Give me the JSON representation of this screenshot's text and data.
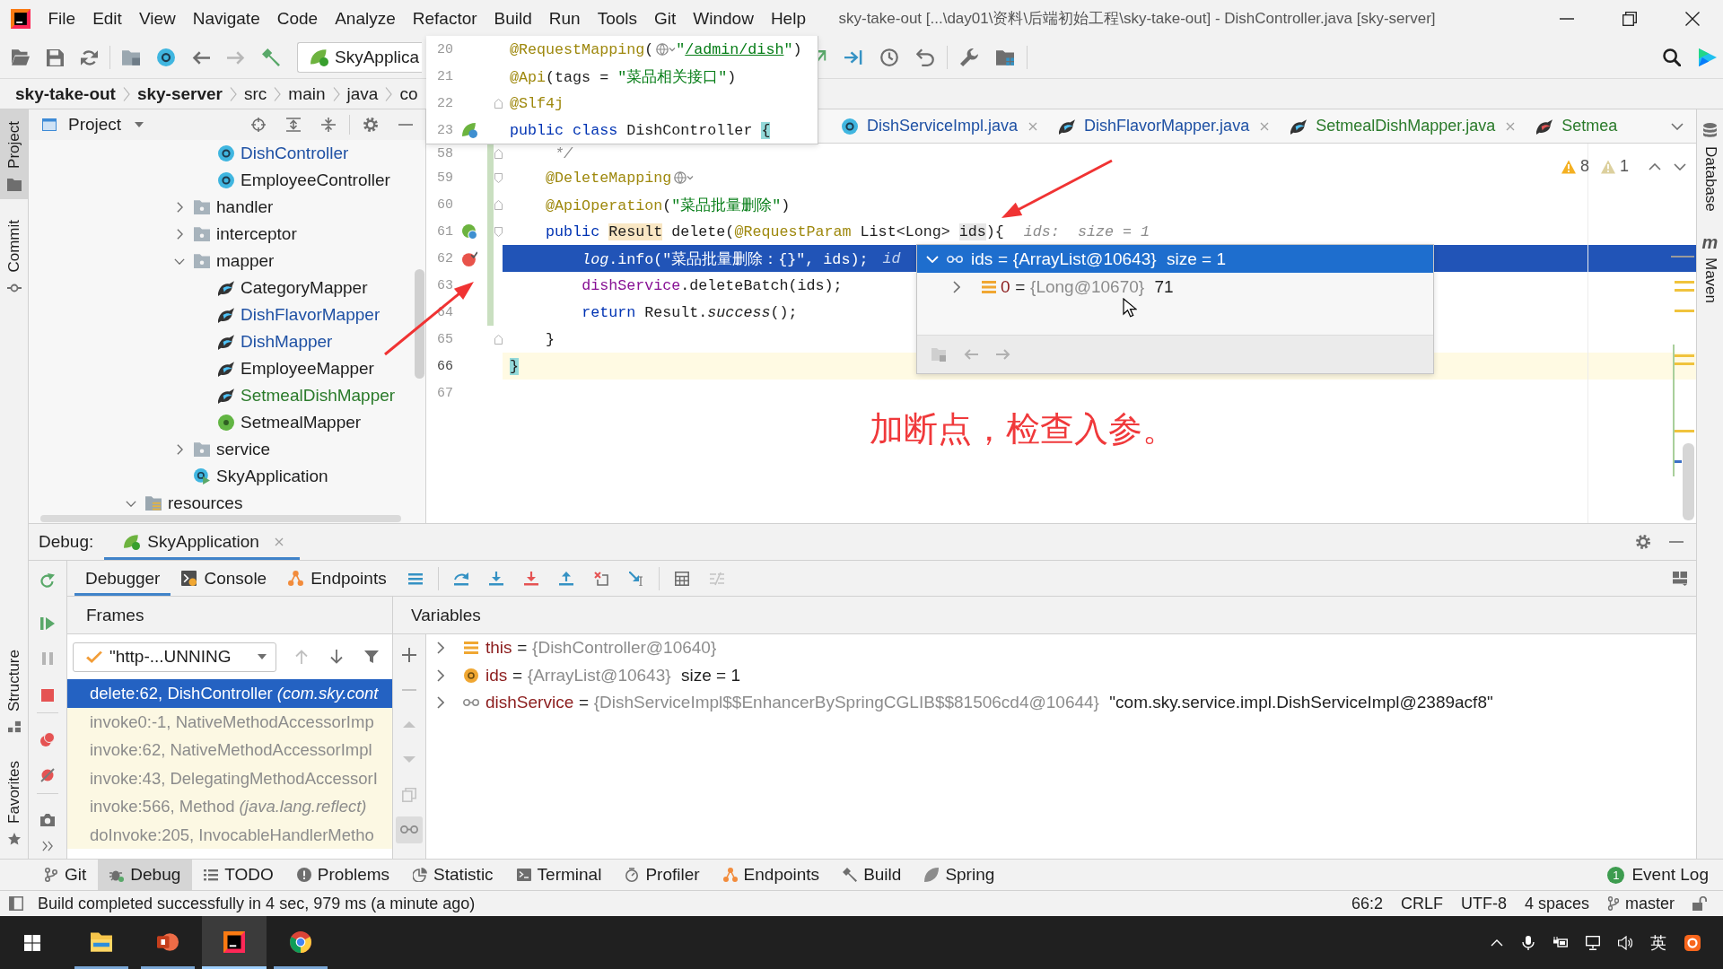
{
  "title_bar": {
    "menu": [
      "File",
      "Edit",
      "View",
      "Navigate",
      "Code",
      "Analyze",
      "Refactor",
      "Build",
      "Run",
      "Tools",
      "Git",
      "Window",
      "Help"
    ],
    "title": "sky-take-out [...\\day01\\资料\\后端初始工程\\sky-take-out] - DishController.java [sky-server]"
  },
  "toolbar": {
    "run_configuration": "SkyApplica"
  },
  "breadcrumb": [
    {
      "label": "sky-take-out",
      "kind": "module"
    },
    {
      "label": "sky-server",
      "kind": "module"
    },
    {
      "label": "src",
      "kind": "directory"
    },
    {
      "label": "main",
      "kind": "directory"
    },
    {
      "label": "java",
      "kind": "directory"
    },
    {
      "label": "co",
      "kind": "directory"
    }
  ],
  "left_strip": {
    "top": [
      {
        "label": "Project",
        "selected": true
      },
      {
        "label": "Commit",
        "selected": false
      }
    ],
    "bottom": [
      {
        "label": "Structure",
        "selected": false
      },
      {
        "label": "Favorites",
        "selected": false
      }
    ]
  },
  "right_strip": [
    {
      "label": "Database"
    },
    {
      "label": "Maven",
      "glyph": "m"
    }
  ],
  "project": {
    "title": "Project",
    "tree": [
      {
        "children": [
          {
            "children": [
              {
                "children": [
                  {
                    "label": "DishController",
                    "kind": "class",
                    "color": "#1f51a4"
                  },
                  {
                    "label": "EmployeeController",
                    "kind": "class",
                    "color": "#1e1e1e"
                  }
                ]
              },
              {
                "label": "handler",
                "kind": "package",
                "color": "#1e1e1e",
                "expanded": false
              },
              {
                "label": "interceptor",
                "kind": "package",
                "color": "#1e1e1e",
                "expanded": false
              },
              {
                "label": "mapper",
                "kind": "package",
                "color": "#1e1e1e",
                "expanded": true,
                "children": [
                  {
                    "label": "CategoryMapper",
                    "kind": "mapper",
                    "color": "#1e1e1e"
                  },
                  {
                    "label": "DishFlavorMapper",
                    "kind": "mapper",
                    "color": "#1f51a4"
                  },
                  {
                    "label": "DishMapper",
                    "kind": "mapper",
                    "color": "#1f51a4"
                  },
                  {
                    "label": "EmployeeMapper",
                    "kind": "mapper",
                    "color": "#1e1e1e"
                  },
                  {
                    "label": "SetmealDishMapper",
                    "kind": "mapper",
                    "color": "#2a7a2a"
                  },
                  {
                    "label": "SetmealMapper",
                    "kind": "interface",
                    "color": "#1e1e1e"
                  }
                ]
              },
              {
                "label": "service",
                "kind": "package",
                "color": "#1e1e1e",
                "expanded": false
              },
              {
                "label": "SkyApplication",
                "kind": "application",
                "color": "#1e1e1e"
              }
            ]
          }
        ]
      },
      {
        "label": "resources",
        "kind": "resources",
        "color": "#1e1e1e",
        "expanded": true
      }
    ]
  },
  "editor": {
    "tabs": [
      {
        "label": "DishServiceImpl.java",
        "kind": "class",
        "color": "#1f51a4",
        "selected": false,
        "clipped": false
      },
      {
        "label": "DishFlavorMapper.java",
        "kind": "mapper",
        "color": "#1f51a4",
        "selected": false,
        "clipped": false
      },
      {
        "label": "SetmealDishMapper.java",
        "kind": "mapper",
        "color": "#2a7a2a",
        "selected": false,
        "clipped": false
      },
      {
        "label": "Setmea",
        "kind": "mapper_xml",
        "color": "#2a7a2a",
        "selected": false,
        "clipped": true
      }
    ],
    "inspections": {
      "warnings": "8",
      "weak_warnings": "1"
    },
    "sticky_lines": [
      {
        "number": "20",
        "fold_start": false,
        "fold_end": false,
        "bean_marker": false,
        "tokens": [
          {
            "text": "@RequestMapping",
            "kind": "annotation"
          },
          {
            "text": "(",
            "kind": "plain"
          },
          {
            "kind": "endpoint_icon"
          },
          {
            "text": "\"",
            "kind": "string"
          },
          {
            "text": "/admin/dish",
            "kind": "url"
          },
          {
            "text": "\"",
            "kind": "string"
          },
          {
            "text": ")",
            "kind": "plain"
          }
        ]
      },
      {
        "number": "21",
        "fold_start": false,
        "fold_end": false,
        "bean_marker": false,
        "tokens": [
          {
            "text": "@Api",
            "kind": "annotation"
          },
          {
            "text": "(tags = ",
            "kind": "plain"
          },
          {
            "text": "\"菜品相关接口\"",
            "kind": "string"
          },
          {
            "text": ")",
            "kind": "plain"
          }
        ]
      },
      {
        "number": "22",
        "fold_start": false,
        "fold_end": true,
        "bean_marker": false,
        "tokens": [
          {
            "text": "@Slf4j",
            "kind": "annotation"
          }
        ]
      },
      {
        "number": "23",
        "fold_start": false,
        "fold_end": false,
        "bean_marker": true,
        "tokens": [
          {
            "text": "public",
            "kind": "keyword"
          },
          {
            "text": " class",
            "kind": "keyword"
          },
          {
            "text": " DishController ",
            "kind": "plain"
          },
          {
            "text": "{",
            "kind": "brace"
          }
        ]
      }
    ],
    "lines": [
      {
        "number": "58",
        "kind": "plain",
        "fold_start": false,
        "fold_end": true,
        "changed": true,
        "breakpoint": false,
        "endpoint_marker": false,
        "tokens": [
          {
            "text": "     */",
            "kind": "comment"
          }
        ]
      },
      {
        "number": "59",
        "kind": "plain",
        "fold_start": true,
        "fold_end": false,
        "changed": true,
        "breakpoint": false,
        "endpoint_marker": false,
        "tokens": [
          {
            "text": "    @DeleteMapping",
            "kind": "annotation"
          },
          {
            "kind": "endpoint_icon"
          }
        ]
      },
      {
        "number": "60",
        "kind": "plain",
        "fold_start": false,
        "fold_end": true,
        "changed": true,
        "breakpoint": false,
        "endpoint_marker": false,
        "tokens": [
          {
            "text": "    @ApiOperation",
            "kind": "annotation"
          },
          {
            "text": "(",
            "kind": "plain"
          },
          {
            "text": "\"菜品批量删除\"",
            "kind": "string"
          },
          {
            "text": ")",
            "kind": "plain"
          }
        ]
      },
      {
        "number": "61",
        "kind": "plain",
        "fold_start": true,
        "fold_end": false,
        "changed": true,
        "breakpoint": false,
        "endpoint_marker": true,
        "tokens": [
          {
            "text": "    public ",
            "kind": "keyword"
          },
          {
            "text": "Result",
            "kind": "type_usage"
          },
          {
            "text": " delete(",
            "kind": "plain"
          },
          {
            "text": "@RequestParam",
            "kind": "annotation"
          },
          {
            "text": " List<Long> ",
            "kind": "plain"
          },
          {
            "text": "ids",
            "kind": "usage"
          },
          {
            "text": "){",
            "kind": "plain"
          },
          {
            "text": "ids:  size = 1",
            "kind": "hint"
          }
        ]
      },
      {
        "number": "62",
        "kind": "execution",
        "fold_start": false,
        "fold_end": false,
        "changed": true,
        "breakpoint": true,
        "endpoint_marker": false,
        "tokens": [
          {
            "text": "        log",
            "kind": "static_field"
          },
          {
            "text": ".info(",
            "kind": "plain"
          },
          {
            "text": "\"菜品批量删除：{}\"",
            "kind": "string"
          },
          {
            "text": ", ids);",
            "kind": "plain"
          },
          {
            "text": "id",
            "kind": "hint"
          }
        ]
      },
      {
        "number": "63",
        "kind": "plain",
        "fold_start": false,
        "fold_end": false,
        "changed": true,
        "breakpoint": false,
        "endpoint_marker": false,
        "tokens": [
          {
            "text": "        dishService",
            "kind": "field"
          },
          {
            "text": ".deleteBatch(ids);",
            "kind": "plain"
          }
        ]
      },
      {
        "number": "64",
        "kind": "plain",
        "fold_start": false,
        "fold_end": false,
        "changed": true,
        "breakpoint": false,
        "endpoint_marker": false,
        "tokens": [
          {
            "text": "        return",
            "kind": "keyword"
          },
          {
            "text": " Result.",
            "kind": "plain"
          },
          {
            "text": "success",
            "kind": "static"
          },
          {
            "text": "();",
            "kind": "plain"
          }
        ]
      },
      {
        "number": "65",
        "kind": "plain",
        "fold_start": false,
        "fold_end": true,
        "changed": false,
        "breakpoint": false,
        "endpoint_marker": false,
        "tokens": [
          {
            "text": "    }",
            "kind": "plain"
          }
        ]
      },
      {
        "number": "66",
        "kind": "caret",
        "fold_start": false,
        "fold_end": false,
        "changed": false,
        "breakpoint": false,
        "endpoint_marker": false,
        "tokens": [
          {
            "text": "}",
            "kind": "brace"
          }
        ]
      },
      {
        "number": "67",
        "kind": "plain",
        "fold_start": false,
        "fold_end": false,
        "changed": false,
        "breakpoint": false,
        "endpoint_marker": false
      }
    ],
    "value_popup": {
      "root": {
        "name": "ids",
        "sign": "=",
        "ref": "{ArrayList@10643}",
        "value": "size = 1",
        "expanded": true,
        "selected": true
      },
      "children": [
        {
          "name": "0",
          "sign": "=",
          "ref": "{Long@10670}",
          "value": "71",
          "expanded": false,
          "selected": false
        }
      ]
    },
    "annotation": "加断点，检查入参。"
  },
  "debug": {
    "title": "Debug:",
    "session": {
      "label": "SkyApplication",
      "selected": true
    },
    "tabs": [
      {
        "label": "Debugger",
        "selected": true
      },
      {
        "label": "Console",
        "selected": false
      },
      {
        "label": "Endpoints",
        "selected": false
      }
    ],
    "frames": {
      "title": "Frames",
      "thread": "\"http-...UNNING",
      "items": [
        {
          "text": "delete:62, DishController *(com.sky.cont*",
          "selected": true,
          "library": false
        },
        {
          "text": "invoke0:-1, NativeMethodAccessorImp",
          "selected": false,
          "library": true
        },
        {
          "text": "invoke:62, NativeMethodAccessorImpl",
          "selected": false,
          "library": true
        },
        {
          "text": "invoke:43, DelegatingMethodAccessorI",
          "selected": false,
          "library": true
        },
        {
          "text": "invoke:566, Method *(java.lang.reflect)*",
          "selected": false,
          "library": true
        },
        {
          "text": "doInvoke:205, InvocableHandlerMetho",
          "selected": false,
          "library": true
        }
      ]
    },
    "variables": {
      "title": "Variables",
      "show_watches": true,
      "items": [
        {
          "name": "this",
          "sign": "=",
          "ref": "{DishController@10640}",
          "kind": "field_list",
          "expanded": false
        },
        {
          "name": "ids",
          "sign": "=",
          "ref": "{ArrayList@10643}",
          "value": "size = 1",
          "kind": "parameter",
          "expanded": false
        },
        {
          "name": "dishService",
          "sign": "=",
          "ref": "{DishServiceImpl$$EnhancerBySpringCGLIB$$81506cd4@10644}",
          "value": "\"com.sky.service.impl.DishServiceImpl@2389acf8\"",
          "kind": "watch",
          "expanded": false
        }
      ]
    }
  },
  "tool_windows": {
    "items": [
      {
        "label": "Git",
        "selected": false
      },
      {
        "label": "Debug",
        "selected": true
      },
      {
        "label": "TODO",
        "selected": false
      },
      {
        "label": "Problems",
        "selected": false
      },
      {
        "label": "Statistic",
        "selected": false
      },
      {
        "label": "Terminal",
        "selected": false
      },
      {
        "label": "Profiler",
        "selected": false
      },
      {
        "label": "Endpoints",
        "selected": false
      },
      {
        "label": "Build",
        "selected": false
      },
      {
        "label": "Spring",
        "selected": false
      }
    ],
    "event_log": {
      "label": "Event Log",
      "count": "1"
    }
  },
  "status_bar": {
    "message": "Build completed successfully in 4 sec, 979 ms (a minute ago)",
    "caret_position": "66:2",
    "line_separator": "CRLF",
    "encoding": "UTF-8",
    "indent": "4 spaces",
    "branch": "master"
  },
  "taskbar": {
    "apps": [
      {
        "selected": false
      },
      {
        "selected": false
      },
      {
        "selected": true
      },
      {
        "selected": false
      }
    ],
    "input_method": "英"
  }
}
